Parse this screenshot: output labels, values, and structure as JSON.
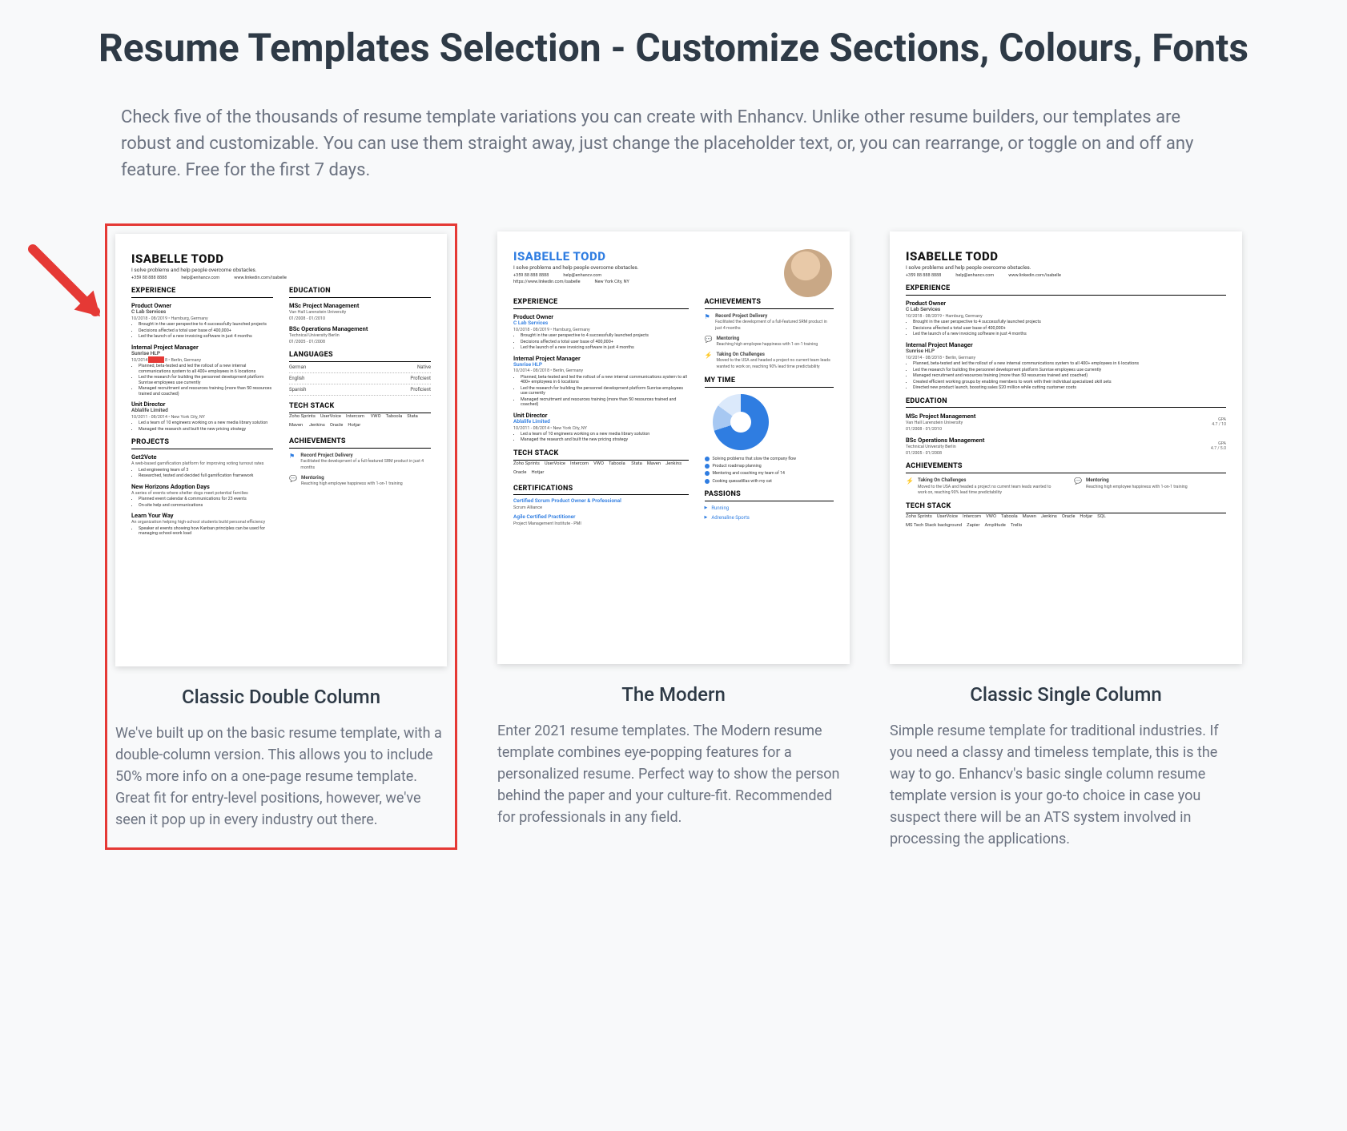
{
  "pageTitle": "Resume Templates Selection - Customize Sections, Colours, Fonts",
  "intro": "Check five of the thousands of resume template variations you can create with Enhancv. Unlike other resume builders, our templates are robust and customizable. You can use them straight away, just change the placeholder text, or, you can rearrange, or toggle on and off any feature. Free for the first 7 days.",
  "resume": {
    "name": "ISABELLE TODD",
    "tagline": "I solve problems and help people overcome obstacles.",
    "phone": "+359 88 888 8888",
    "email": "help@enhancv.com",
    "link": "www.linkedin.com/isabelle",
    "linkAlt": "https://www.linkedin.com/isabelle",
    "location": "New York City, NY",
    "sections": {
      "experience": "EXPERIENCE",
      "education": "EDUCATION",
      "languages": "LANGUAGES",
      "techstack": "TECH STACK",
      "achievements": "ACHIEVEMENTS",
      "projects": "PROJECTS",
      "certifications": "CERTIFICATIONS",
      "mytime": "MY TIME",
      "passions": "PASSIONS"
    },
    "jobs": {
      "po": "Product Owner",
      "poCo": "C Lab Services",
      "poMeta": "10/2018 - 08/2019   •  Hamburg, Germany",
      "poBul1": "Brought in the user perspective to 4 successfully launched projects",
      "poBul2": "Decisions affected a total user base of 400,000+",
      "poBul3": "Led the launch of a new invoicing software in just 4 months",
      "ipm": "Internal Project Manager",
      "ipmCo": "Sunrise HLP",
      "ipmMeta": "10/2014 - 08/2018   •  Berlin, Germany",
      "ipmBul1": "Planned, beta-tested and led the rollout of a new internal communications system to all 400+ employees in 6 locations",
      "ipmBul2": "Led the research for building the personnel development platform Sunrise employees use currently",
      "ipmBul3": "Managed recruitment and resources training (more than 50 resources trained and coached)",
      "ud": "Unit Director",
      "udCo": "Ablalife Limited",
      "udMeta": "10/2011 - 08/2014   •  New York City, NY",
      "udBul1": "Led a team of 10 engineers working on a new media library solution",
      "udBul2": "Managed the research and built the new pricing strategy"
    },
    "projects": {
      "p1": "Get2Vote",
      "p1d": "A web-based gamification platform for improving voting turnout rates",
      "p1b1": "Led engineering team of 3",
      "p1b2": "Researched, tested and decided full gamification framework",
      "p2": "New Horizons Adoption Days",
      "p2d": "A series of events where shelter dogs meet potential families",
      "p2b1": "Planned event calendar & communications for 23 events",
      "p2b2": "On-site help and communications",
      "p3": "Learn Your Way",
      "p3d": "An organization helping high-school students build personal efficiency",
      "p3b1": "Speaker at events showing how Kanban principles can be used for managing school-work load"
    },
    "education": {
      "e1": "MSc Project Management",
      "e1s": "Van Hall Larenstein University",
      "e1m": "01/2008 - 01/2010",
      "e2": "BSc Operations Management",
      "e2s": "Technical University Berlin",
      "e2m": "01/2005 - 01/2008",
      "gpa1l": "GPA",
      "gpa1": "4.7 / 10",
      "gpa2": "4.7 / 5.0"
    },
    "languages": {
      "l1": "German",
      "l1p": "Native",
      "l2": "English",
      "l2p": "Proficient",
      "l3": "Spanish",
      "l3p": "Proficient"
    },
    "tech": [
      "Zoho Sprints",
      "UserVoice",
      "Intercom",
      "VWO",
      "Taboola",
      "Stata",
      "Maven",
      "Jenkins",
      "Oracle",
      "Hotjar",
      "SQL"
    ],
    "techRow2": [
      "MS Tech Stack background",
      "Zapier",
      "Amplitude",
      "Trello"
    ],
    "achievements": {
      "a1": "Record Project Delivery",
      "a1d": "Facilitated the development of a full-featured SRM product in just 4 months",
      "a2": "Mentoring",
      "a2d": "Reaching high employee happiness with 1-on-1 training",
      "a3": "Taking On Challenges",
      "a3d": "Moved to the USA and headed a project no current team leads wanted to work on, reaching 90% lead time predictability"
    },
    "mytime": {
      "m1": "Solving problems that slow the company flow",
      "m2": "Product roadmap planning",
      "m3": "Mentoring and coaching my team of 14",
      "m4": "Cooking quesadillas with my cat"
    },
    "passions": {
      "p1": "Running",
      "p2": "Adrenaline Sports"
    },
    "certs": {
      "c1": "Certified Scrum Product Owner & Professional",
      "c1s": "Scrum Alliance",
      "c2": "Agile Certified Practitioner",
      "c2s": "Project Management Institute - PMI"
    }
  },
  "templates": [
    {
      "name": "Classic Double Column",
      "desc": "We've built up on the basic resume template, with a double-column version. This allows you to include 50% more info on a one-page resume template. Great fit for entry-level positions, however, we've seen it pop up in every industry out there."
    },
    {
      "name": "The Modern",
      "desc": "Enter 2021 resume templates. The Modern resume template combines eye-popping features for a personalized resume. Perfect way to show the person behind the paper and your culture-fit. Recommended for professionals in any field."
    },
    {
      "name": "Classic Single Column",
      "desc": "Simple resume template for traditional industries. If you need a classy and timeless template, this is the way to go. Enhancv's basic single column resume template version is your go-to choice in case you suspect there will be an ATS system involved in processing the applications."
    }
  ]
}
